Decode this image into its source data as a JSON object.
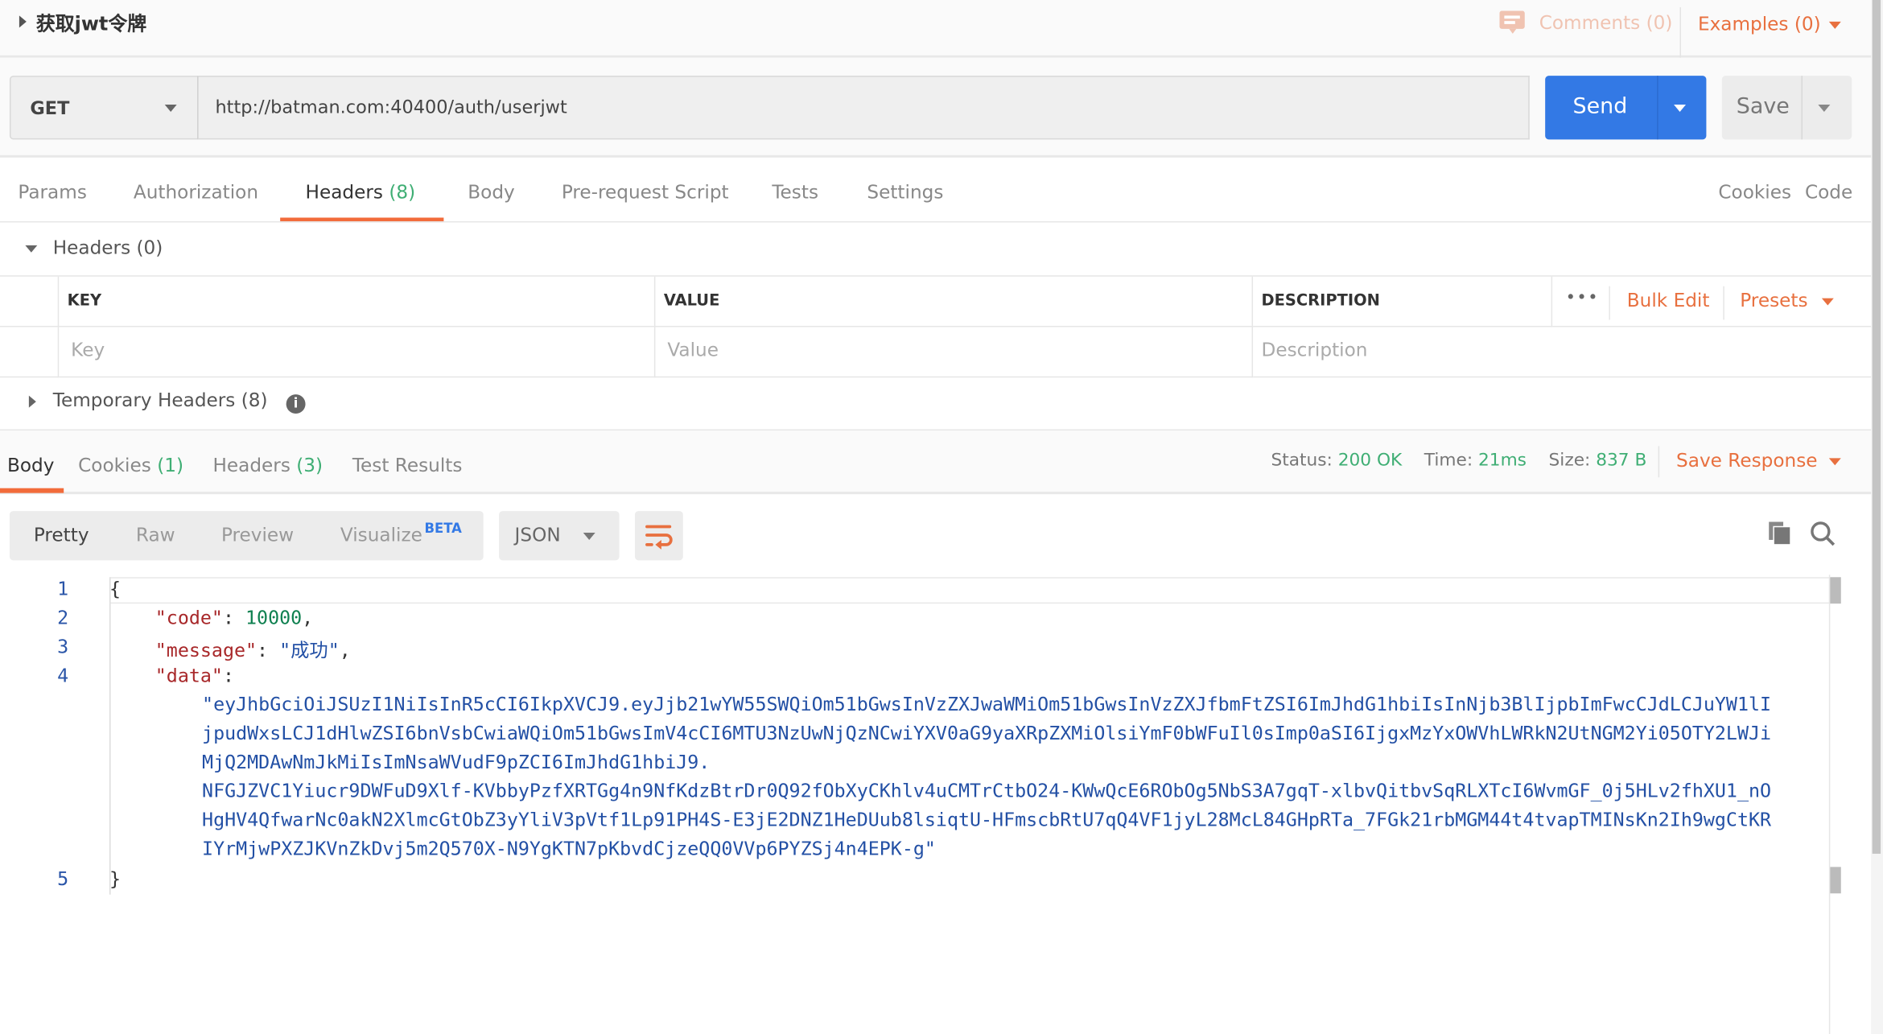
{
  "request_name": "获取jwt令牌",
  "header_links": {
    "comments": "Comments (0)",
    "examples": "Examples (0)"
  },
  "request": {
    "method": "GET",
    "url": "http://batman.com:40400/auth/userjwt",
    "send_label": "Send",
    "save_label": "Save"
  },
  "request_tabs": [
    {
      "label": "Params"
    },
    {
      "label": "Authorization"
    },
    {
      "label": "Headers",
      "count": "(8)",
      "active": true
    },
    {
      "label": "Body"
    },
    {
      "label": "Pre-request Script"
    },
    {
      "label": "Tests"
    },
    {
      "label": "Settings"
    }
  ],
  "request_links": {
    "cookies": "Cookies",
    "code": "Code"
  },
  "headers_section": {
    "title": "Headers (0)",
    "columns": {
      "key": "KEY",
      "value": "VALUE",
      "description": "DESCRIPTION"
    },
    "more": "•••",
    "bulk_edit": "Bulk Edit",
    "presets": "Presets",
    "placeholders": {
      "key": "Key",
      "value": "Value",
      "description": "Description"
    },
    "temporary": "Temporary Headers (8)"
  },
  "response_tabs": [
    {
      "label": "Body",
      "active": true
    },
    {
      "label": "Cookies",
      "count": "(1)"
    },
    {
      "label": "Headers",
      "count": "(3)"
    },
    {
      "label": "Test Results"
    }
  ],
  "response_meta": {
    "status_label": "Status:",
    "status": "200 OK",
    "time_label": "Time:",
    "time": "21ms",
    "size_label": "Size:",
    "size": "837 B",
    "save_response": "Save Response"
  },
  "view_modes": {
    "pretty": "Pretty",
    "raw": "Raw",
    "preview": "Preview",
    "visualize": "Visualize",
    "beta": "BETA",
    "format": "JSON"
  },
  "body": {
    "line_numbers": [
      "1",
      "2",
      "3",
      "4",
      "5"
    ],
    "open_brace": "{",
    "close_brace": "}",
    "code_key": "\"code\"",
    "code_value": "10000",
    "message_key": "\"message\"",
    "message_value": "\"成功\"",
    "data_key": "\"data\"",
    "data_value_lines": [
      "\"eyJhbGciOiJSUzI1NiIsInR5cCI6IkpXVCJ9.eyJjb21wYW55SWQiOm51bGwsInVzZXJwaWMiOm51bGwsInVzZXJfbmFtZSI6ImJhdG1hbiIsInNjb3BlIjpbImFwcCJdLCJuYW1lI",
      "jpudWxsLCJ1dHlwZSI6bnVsbCwiaWQiOm51bGwsImV4cCI6MTU3NzUwNjQzNCwiYXV0aG9yaXRpZXMiOlsiYmF0bWFuIl0sImp0aSI6IjgxMzYxOWVhLWRkN2UtNGM2Yi05OTY2LWJi",
      "MjQ2MDAwNmJkMiIsImNsaWVudF9pZCI6ImJhdG1hbiJ9.",
      "NFGJZVC1Yiucr9DWFuD9Xlf-KVbbyPzfXRTGg4n9NfKdzBtrDr0Q92fObXyCKhlv4uCMTrCtbO24-KWwQcE6RObOg5NbS3A7gqT-xlbvQitbvSqRLXTcI6WvmGF_0j5HLv2fhXU1_nO",
      "HgHV4QfwarNc0akN2XlmcGtObZ3yYliV3pVtf1Lp91PH4S-E3jE2DNZ1HeDUub8lsiqtU-HFmscbRtU7qQ4VF1jyL28McL84GHpRTa_7FGk21rbMGM44t4tvapTMINsKn2Ih9wgCtKR",
      "IYrMjwPXZJKVnZkDvj5m2Q570X-N9YgKTN7pKbvdCjzeQQ0VVp6PYZSj4n4EPK-g\""
    ]
  },
  "colors": {
    "accent": "#f26b3a",
    "send": "#3379e5",
    "success": "#3fae74"
  }
}
